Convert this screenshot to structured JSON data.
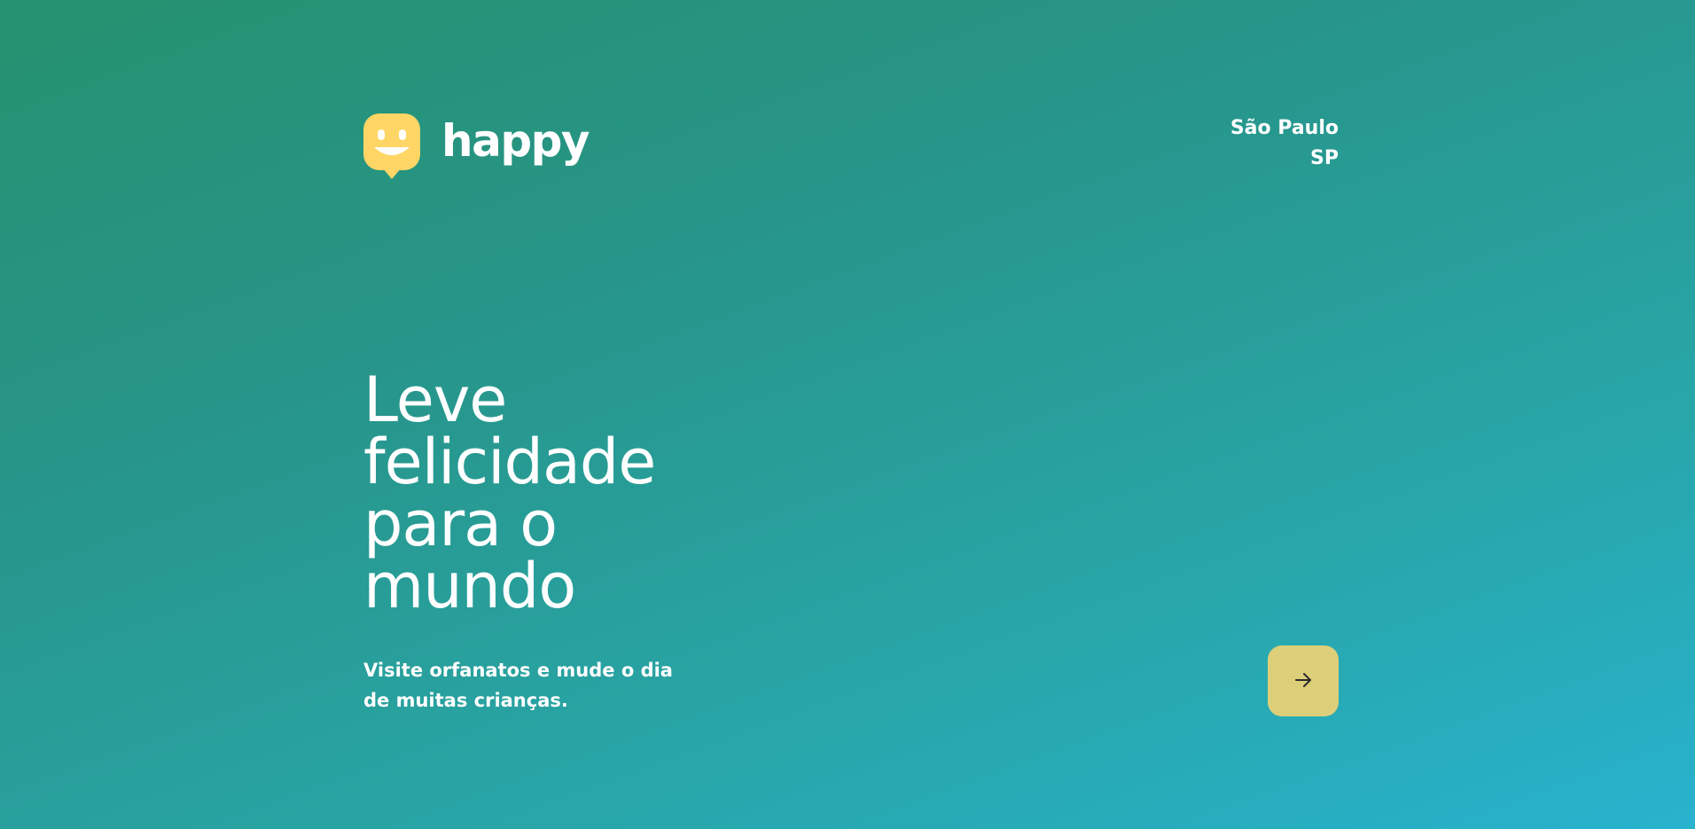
{
  "app": {
    "brand_name": "happy",
    "brand_color": "#FFD666"
  },
  "header": {
    "location": {
      "city": "São Paulo",
      "state": "SP"
    }
  },
  "hero": {
    "title": "Leve felicidade para o mundo",
    "subtitle": "Visite orfanatos e mude o dia de muitas crianças."
  },
  "actions": {
    "enter_button": {
      "icon": "arrow-right-icon",
      "color": "#DDCF79"
    }
  },
  "colors": {
    "background_start": "#26926F",
    "background_end": "#28B2CE",
    "text": "#FFFFFF"
  }
}
